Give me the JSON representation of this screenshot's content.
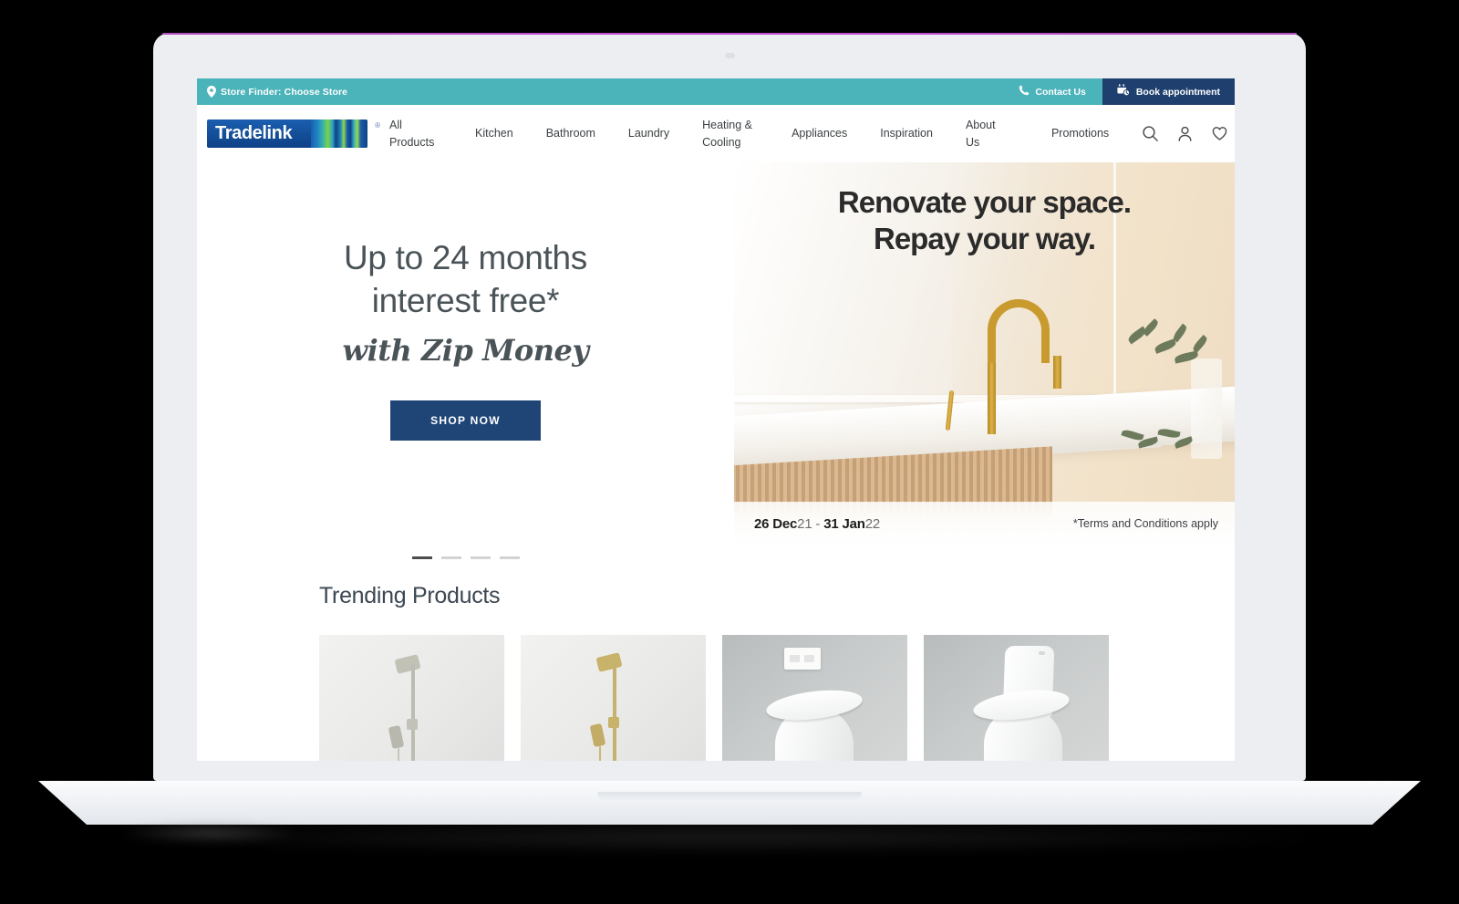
{
  "utility_bar": {
    "store_finder": "Store Finder: Choose Store",
    "contact_us": "Contact Us",
    "book_appointment": "Book appointment",
    "bg_color": "#4bb3ba",
    "book_bg_color": "#1f3f6e"
  },
  "brand": {
    "logo_text": "Tradelink",
    "registered_mark": "®",
    "logo_bg_color": "#134e98"
  },
  "nav": {
    "links": [
      {
        "label": "All\nProducts"
      },
      {
        "label": "Kitchen"
      },
      {
        "label": "Bathroom"
      },
      {
        "label": "Laundry"
      },
      {
        "label": "Heating &\nCooling"
      },
      {
        "label": "Appliances"
      },
      {
        "label": "Inspiration"
      },
      {
        "label": "About\nUs"
      },
      {
        "label": "Promotions"
      }
    ],
    "icons": [
      "search-icon",
      "account-icon",
      "wishlist-heart-icon",
      "cart-icon"
    ]
  },
  "hero": {
    "headline_line1": "Up to 24 months",
    "headline_line2": "interest free*",
    "script_line": "with Zip Money",
    "cta_label": "SHOP NOW",
    "cta_color": "#1f4577",
    "banner_head_line1": "Renovate your space.",
    "banner_head_line2": "Repay your way.",
    "promo_date_start_bold": "26 Dec",
    "promo_date_start_year": "21",
    "promo_date_sep": " - ",
    "promo_date_end_bold": "31 Jan",
    "promo_date_end_year": "22",
    "terms": "*Terms and Conditions apply",
    "carousel": {
      "total": 4,
      "active_index": 0
    }
  },
  "trending": {
    "title": "Trending Products",
    "products": [
      {
        "name": "shower-rail-chrome",
        "type": "shower"
      },
      {
        "name": "shower-rail-brass",
        "type": "shower-gold"
      },
      {
        "name": "wall-faced-toilet-pan",
        "type": "toilet-wall"
      },
      {
        "name": "close-coupled-toilet-suite",
        "type": "toilet-close"
      }
    ]
  },
  "device": {
    "type": "laptop-mockup",
    "lid_color": "#eceef1",
    "accent_line_color": "#c44bd4"
  }
}
